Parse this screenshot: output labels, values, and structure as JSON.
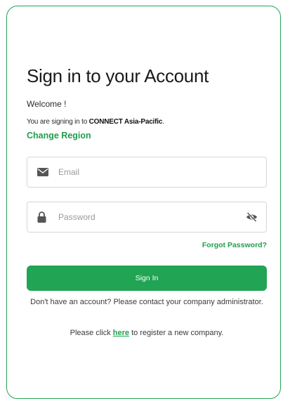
{
  "title": "Sign in to your Account",
  "welcome": "Welcome !",
  "signing_in": {
    "prefix": "You are signing in to",
    "region": "CONNECT Asia-Pacific",
    "suffix": "."
  },
  "change_region_label": "Change Region",
  "email_field": {
    "placeholder": "Email",
    "value": "",
    "icon": "envelope-icon"
  },
  "password_field": {
    "placeholder": "Password",
    "value": "",
    "icon": "lock-icon",
    "toggle_icon": "eye-slash-icon"
  },
  "forgot_password_label": "Forgot Password?",
  "sign_in_label": "Sign In",
  "contact_note": "Don't have an account? Please contact your company administrator.",
  "register": {
    "prefix": "Please click",
    "link": "here",
    "suffix": "to register a new company."
  },
  "colors": {
    "accent": "#21a453",
    "border": "#23a455",
    "field_border": "#d6d6d6"
  }
}
